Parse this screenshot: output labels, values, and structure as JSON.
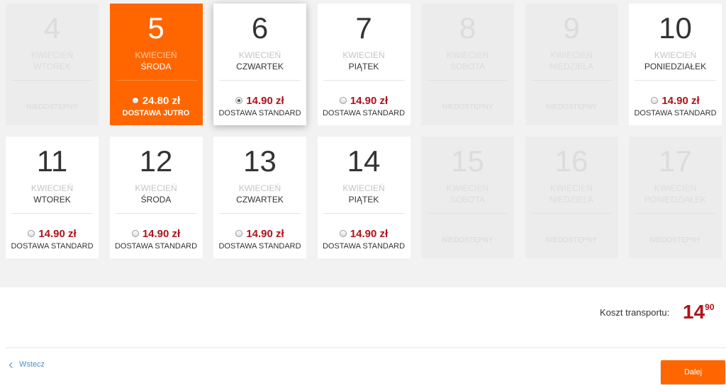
{
  "calendar": {
    "days": [
      {
        "day": "4",
        "month": "KWIECIEŃ",
        "weekday": "WTOREK",
        "available": false,
        "status": "NIEDOSTĘPNY"
      },
      {
        "day": "5",
        "month": "KWIECIEŃ",
        "weekday": "ŚRODA",
        "available": true,
        "highlight": true,
        "price": "24.80 zł",
        "delivery": "DOSTAWA JUTRO",
        "checked": false
      },
      {
        "day": "6",
        "month": "KWIECIEŃ",
        "weekday": "CZWARTEK",
        "available": true,
        "selected": true,
        "price": "14.90 zł",
        "delivery": "DOSTAWA STANDARD",
        "checked": true
      },
      {
        "day": "7",
        "month": "KWIECIEŃ",
        "weekday": "PIĄTEK",
        "available": true,
        "price": "14.90 zł",
        "delivery": "DOSTAWA STANDARD",
        "checked": false
      },
      {
        "day": "8",
        "month": "KWIECIEŃ",
        "weekday": "SOBOTA",
        "available": false,
        "status": "NIEDOSTĘPNY"
      },
      {
        "day": "9",
        "month": "KWIECIEŃ",
        "weekday": "NIEDZIELA",
        "available": false,
        "status": "NIEDOSTĘPNY"
      },
      {
        "day": "10",
        "month": "KWIECIEŃ",
        "weekday": "PONIEDZIAŁEK",
        "available": true,
        "price": "14.90 zł",
        "delivery": "DOSTAWA STANDARD",
        "checked": false
      },
      {
        "day": "11",
        "month": "KWIECIEŃ",
        "weekday": "WTOREK",
        "available": true,
        "price": "14.90 zł",
        "delivery": "DOSTAWA STANDARD",
        "checked": false
      },
      {
        "day": "12",
        "month": "KWIECIEŃ",
        "weekday": "ŚRODA",
        "available": true,
        "price": "14.90 zł",
        "delivery": "DOSTAWA STANDARD",
        "checked": false
      },
      {
        "day": "13",
        "month": "KWIECIEŃ",
        "weekday": "CZWARTEK",
        "available": true,
        "price": "14.90 zł",
        "delivery": "DOSTAWA STANDARD",
        "checked": false
      },
      {
        "day": "14",
        "month": "KWIECIEŃ",
        "weekday": "PIĄTEK",
        "available": true,
        "price": "14.90 zł",
        "delivery": "DOSTAWA STANDARD",
        "checked": false
      },
      {
        "day": "15",
        "month": "KWIECIEŃ",
        "weekday": "SOBOTA",
        "available": false,
        "status": "NIEDOSTĘPNY"
      },
      {
        "day": "16",
        "month": "KWIECIEŃ",
        "weekday": "NIEDZIELA",
        "available": false,
        "status": "NIEDOSTĘPNY"
      },
      {
        "day": "17",
        "month": "KWIECIEŃ",
        "weekday": "PONIEDZIAŁEK",
        "available": false,
        "status": "NIEDOSTĘPNY"
      }
    ]
  },
  "summary": {
    "cost_label": "Koszt transportu:",
    "cost_main": "14",
    "cost_decimals": "90"
  },
  "footer": {
    "back_label": "Wstecz",
    "next_label": "Dalej"
  },
  "colors": {
    "accent": "#ff6600",
    "price": "#b0121b",
    "link": "#4a90c8"
  }
}
